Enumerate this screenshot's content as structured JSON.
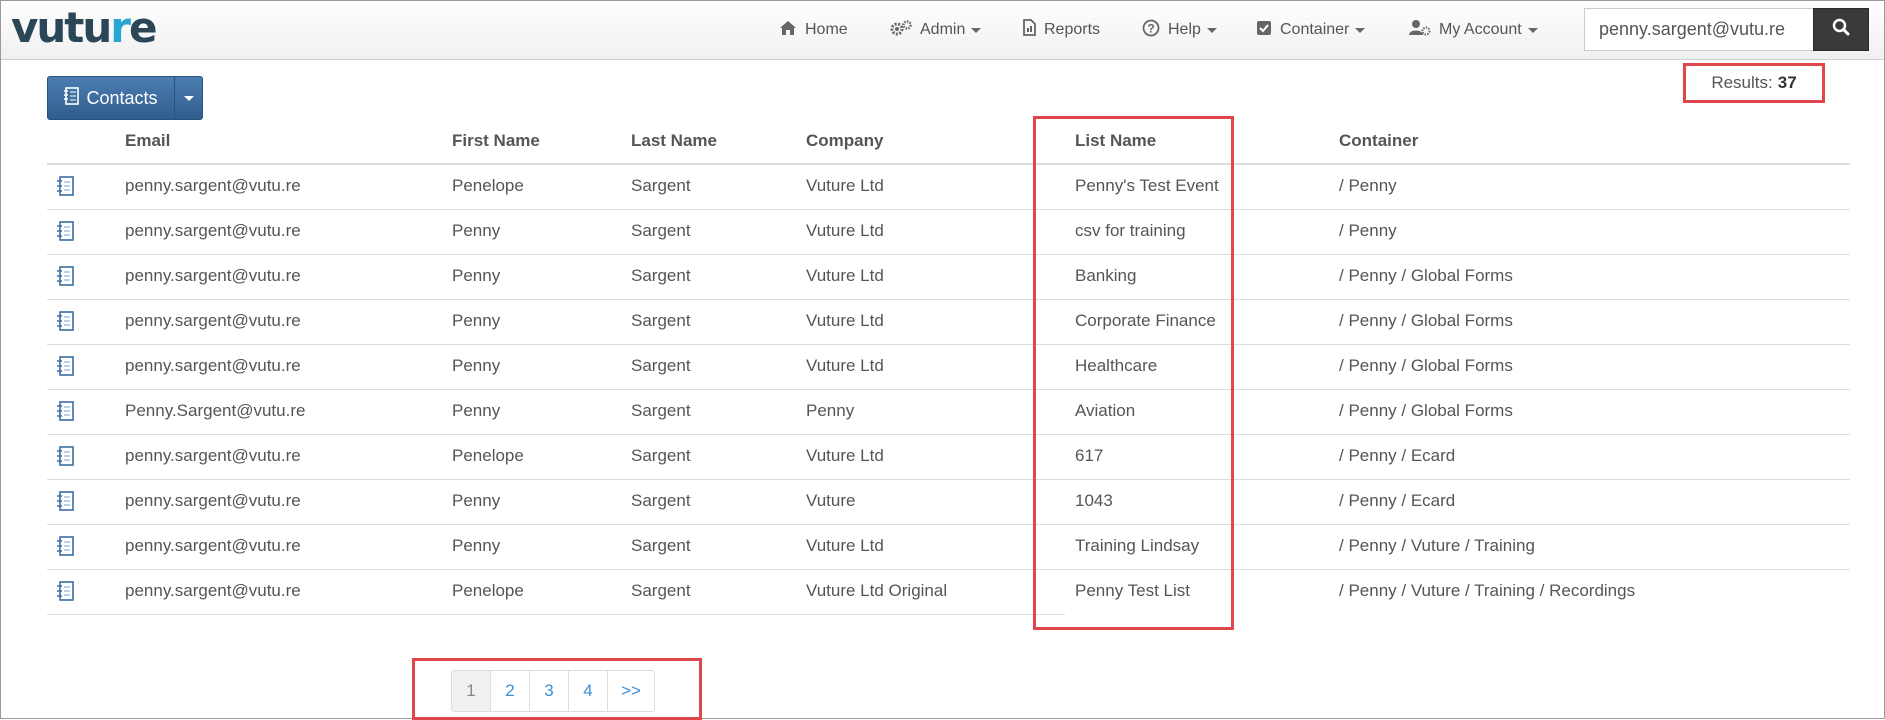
{
  "app": {
    "logo": "vutu",
    "logo_dot": "r",
    "logo_tail": "e"
  },
  "nav": {
    "home": "Home",
    "admin": "Admin",
    "reports": "Reports",
    "help": "Help",
    "container": "Container",
    "account": "My Account"
  },
  "search": {
    "value": "penny.sargent@vutu.re"
  },
  "toolbar": {
    "contacts_label": "Contacts"
  },
  "results": {
    "label": "Results:",
    "count": "37"
  },
  "table": {
    "headers": [
      "Email",
      "First Name",
      "Last Name",
      "Company",
      "List Name",
      "Container"
    ],
    "rows": [
      {
        "email": "penny.sargent@vutu.re",
        "first": "Penelope",
        "last": "Sargent",
        "company": "Vuture Ltd",
        "list": "Penny's Test Event",
        "container": "/ Penny"
      },
      {
        "email": "penny.sargent@vutu.re",
        "first": "Penny",
        "last": "Sargent",
        "company": "Vuture Ltd",
        "list": "csv for training",
        "container": "/ Penny"
      },
      {
        "email": "penny.sargent@vutu.re",
        "first": "Penny",
        "last": "Sargent",
        "company": "Vuture Ltd",
        "list": "Banking",
        "container": "/ Penny / Global Forms"
      },
      {
        "email": "penny.sargent@vutu.re",
        "first": "Penny",
        "last": "Sargent",
        "company": "Vuture Ltd",
        "list": "Corporate Finance",
        "container": "/ Penny / Global Forms"
      },
      {
        "email": "penny.sargent@vutu.re",
        "first": "Penny",
        "last": "Sargent",
        "company": "Vuture Ltd",
        "list": "Healthcare",
        "container": "/ Penny / Global Forms"
      },
      {
        "email": "Penny.Sargent@vutu.re",
        "first": "Penny",
        "last": "Sargent",
        "company": "Penny",
        "list": "Aviation",
        "container": "/ Penny / Global Forms"
      },
      {
        "email": "penny.sargent@vutu.re",
        "first": "Penelope",
        "last": "Sargent",
        "company": "Vuture Ltd",
        "list": "617",
        "container": "/ Penny / Ecard"
      },
      {
        "email": "penny.sargent@vutu.re",
        "first": "Penny",
        "last": "Sargent",
        "company": "Vuture",
        "list": "1043",
        "container": "/ Penny / Ecard"
      },
      {
        "email": "penny.sargent@vutu.re",
        "first": "Penny",
        "last": "Sargent",
        "company": "Vuture Ltd",
        "list": "Training Lindsay",
        "container": "/ Penny / Vuture / Training"
      },
      {
        "email": "penny.sargent@vutu.re",
        "first": "Penelope",
        "last": "Sargent",
        "company": "Vuture Ltd Original",
        "list": "Penny Test List",
        "container": "/ Penny / Vuture / Training / Recordings"
      }
    ]
  },
  "pagination": {
    "pages": [
      "1",
      "2",
      "3",
      "4"
    ],
    "next": ">>",
    "current": "1"
  },
  "colors": {
    "brand": "#2b4757",
    "accent": "#2aa7d0",
    "primary_button": "#3a6ea5",
    "highlight": "#e0474c",
    "link": "#3a8fd6"
  }
}
